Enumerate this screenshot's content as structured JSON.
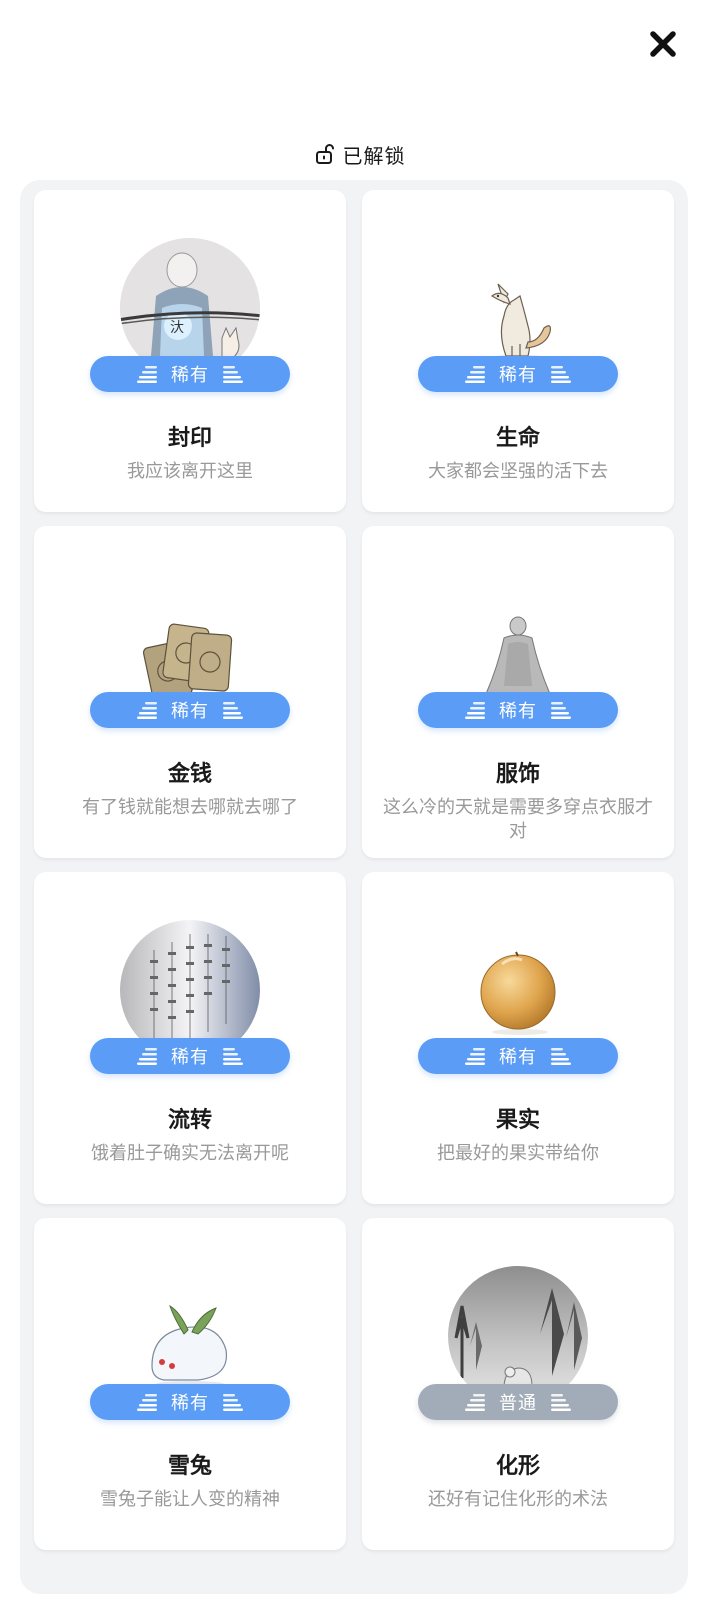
{
  "header": {
    "close_icon": "close-icon",
    "lock_icon": "unlock-icon",
    "label": "已解锁"
  },
  "colors": {
    "rare_badge": "#5b9cf6",
    "common_badge": "#a2acb8",
    "panel_bg": "#f2f3f5"
  },
  "cards": [
    {
      "title": "封印",
      "desc": "我应该离开这里",
      "badge": "稀有",
      "image": "girl-and-cat-painting"
    },
    {
      "title": "生命",
      "desc": "大家都会坚强的活下去",
      "badge": "稀有",
      "image": "fox"
    },
    {
      "title": "金钱",
      "desc": "有了钱就能想去哪就去哪了",
      "badge": "稀有",
      "image": "gold-coins"
    },
    {
      "title": "服饰",
      "desc": "这么冷的天就是需要多穿点衣服才对",
      "badge": "稀有",
      "image": "robed-figure"
    },
    {
      "title": "流转",
      "desc": "饿着肚子确实无法离开呢",
      "badge": "稀有",
      "image": "poem-scroll"
    },
    {
      "title": "果实",
      "desc": "把最好的果实带给你",
      "badge": "稀有",
      "image": "orange-fruit"
    },
    {
      "title": "雪兔",
      "desc": "雪兔子能让人变的精神",
      "badge": "稀有",
      "image": "snow-rabbit"
    },
    {
      "title": "化形",
      "desc": "还好有记住化形的术法",
      "badge": "普通",
      "image": "snowy-forest-fox"
    }
  ]
}
